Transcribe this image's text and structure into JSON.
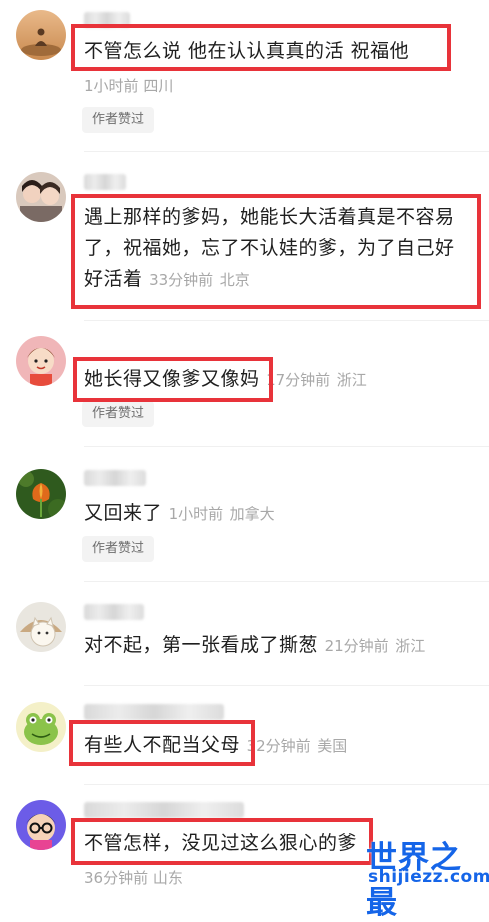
{
  "comments": [
    {
      "text": "不管怎么说 他在认认真真的活 祝福他",
      "time": "1小时前",
      "location": "四川",
      "badge": "作者赞过",
      "avatar_icon": "meditating-person-avatar-icon"
    },
    {
      "text_line1": "遇上那样的爹妈，她能长大活着真是不容易",
      "text_line2": "了，祝福她，忘了不认娃的爹，为了自己好",
      "text_line3": "好活着",
      "time": "33分钟前",
      "location": "北京",
      "avatar_icon": "two-girls-avatar-icon"
    },
    {
      "text": "她长得又像爹又像妈",
      "time": "17分钟前",
      "location": "浙江",
      "badge": "作者赞过",
      "avatar_icon": "cartoon-girl-avatar-icon"
    },
    {
      "text": "又回来了",
      "time": "1小时前",
      "location": "加拿大",
      "badge": "作者赞过",
      "avatar_icon": "tulip-flower-avatar-icon"
    },
    {
      "text": "对不起，第一张看成了撕葱",
      "time": "21分钟前",
      "location": "浙江",
      "avatar_icon": "cartoon-cat-avatar-icon"
    },
    {
      "text": "有些人不配当父母",
      "time": "32分钟前",
      "location": "美国",
      "avatar_icon": "green-frog-avatar-icon"
    },
    {
      "text": "不管怎样，没见过这么狠心的爹",
      "time": "36分钟前",
      "location": "山东",
      "avatar_icon": "cartoon-glasses-avatar-icon"
    }
  ],
  "watermark": {
    "line1": "世界之最",
    "line2": "shijiezz.com"
  },
  "colors": {
    "highlight_box": "#e8333a",
    "meta_text": "#a8a8a8",
    "watermark": "#1565e8"
  }
}
